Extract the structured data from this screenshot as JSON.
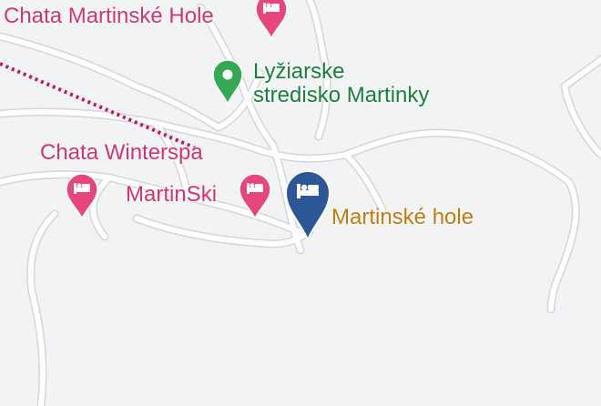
{
  "map": {
    "colors": {
      "background": "#f1f3f4",
      "road": "#ffffff",
      "road_edge": "#d3d6da",
      "trail": "#c2185b",
      "lodging": "#d6336c",
      "park": "#188038",
      "selected_pin": "#2b5797",
      "selected_label": "#c5790d"
    },
    "places": [
      {
        "id": "chata-martinske-hole",
        "label": "Chata Martinské Hole",
        "category": "lodging",
        "icon": "bed-icon"
      },
      {
        "id": "lyziarske-stredisko",
        "label_line1": "Lyžiarske",
        "label_line2": "stredisko Martinky",
        "category": "park",
        "icon": "pin-icon"
      },
      {
        "id": "chata-winterspa",
        "label": "Chata Winterspa",
        "category": "lodging",
        "icon": "bed-icon"
      },
      {
        "id": "martinski",
        "label": "MartinSki",
        "category": "lodging",
        "icon": "bed-icon"
      },
      {
        "id": "martinske-hole",
        "label": "Martinské hole",
        "category": "selected",
        "icon": "bed-icon"
      }
    ]
  }
}
